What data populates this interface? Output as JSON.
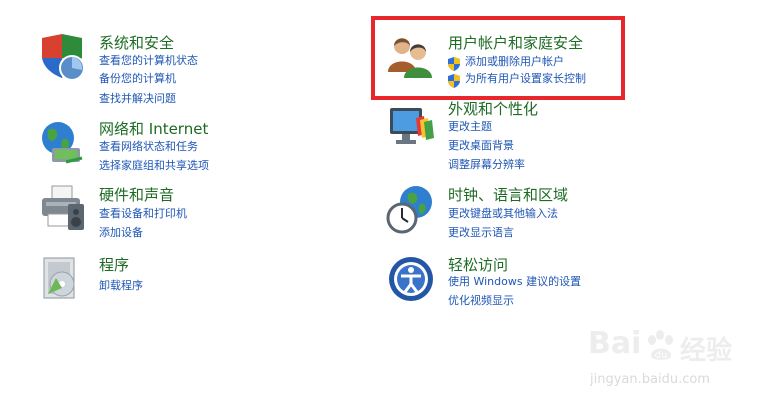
{
  "categories": [
    {
      "title": "系统和安全",
      "links": [
        "查看您的计算机状态",
        "备份您的计算机",
        "查找并解决问题"
      ],
      "icon": "security-shield-icon"
    },
    {
      "title": "网络和 Internet",
      "links": [
        "查看网络状态和任务",
        "选择家庭组和共享选项"
      ],
      "icon": "network-globe-icon"
    },
    {
      "title": "硬件和声音",
      "links": [
        "查看设备和打印机",
        "添加设备"
      ],
      "icon": "printer-icon"
    },
    {
      "title": "程序",
      "links": [
        "卸载程序"
      ],
      "icon": "programs-icon"
    },
    {
      "title": "用户帐户和家庭安全",
      "links": [
        "添加或删除用户帐户",
        "为所有用户设置家长控制"
      ],
      "icon": "users-icon"
    },
    {
      "title": "外观和个性化",
      "links": [
        "更改主题",
        "更改桌面背景",
        "调整屏幕分辨率"
      ],
      "icon": "monitor-palette-icon"
    },
    {
      "title": "时钟、语言和区域",
      "links": [
        "更改键盘或其他输入法",
        "更改显示语言"
      ],
      "icon": "clock-globe-icon"
    },
    {
      "title": "轻松访问",
      "links": [
        "使用 Windows 建议的设置",
        "优化视频显示"
      ],
      "icon": "ease-of-access-icon"
    }
  ],
  "watermark": {
    "brand_left": "Bai",
    "brand_right": "经验",
    "url": "jingyan.baidu.com"
  },
  "colors": {
    "title": "#1e6b24",
    "link": "#1f57b5",
    "highlight": "#e8262c"
  }
}
